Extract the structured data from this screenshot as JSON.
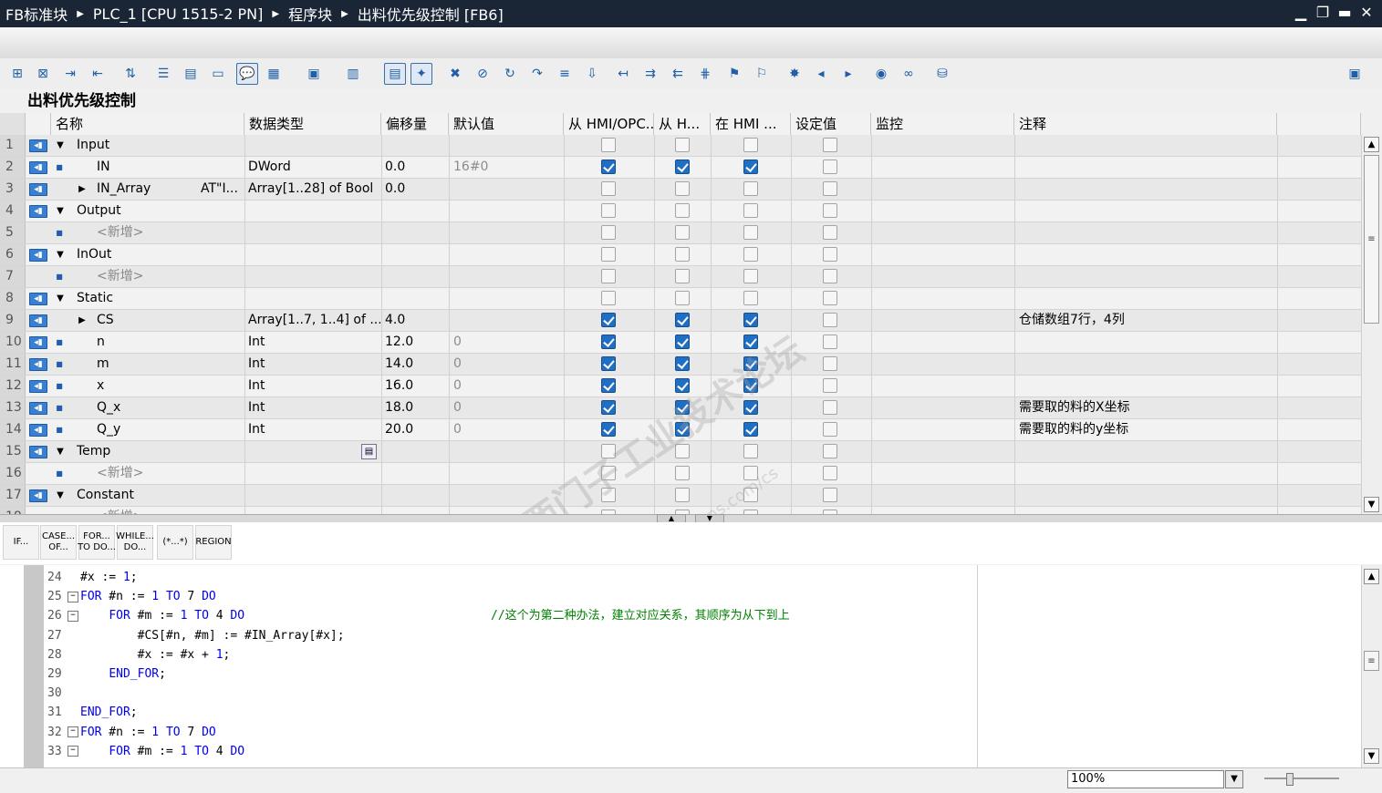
{
  "titlebar": {
    "crumbs": [
      "FB标准块",
      "PLC_1 [CPU 1515-2 PN]",
      "程序块",
      "出料优先级控制 [FB6]"
    ],
    "controls": [
      "▁",
      "❐",
      "▬",
      "✕"
    ]
  },
  "block_title": "出料优先级控制",
  "table": {
    "headers": [
      "名称",
      "数据类型",
      "偏移量",
      "默认值",
      "从 HMI/OPC...",
      "从 H...",
      "在 HMI ...",
      "设定值",
      "监控",
      "注释"
    ],
    "rows": [
      {
        "n": "1",
        "indent": 0,
        "exp": "▼",
        "icon": true,
        "name": "Input",
        "at": "",
        "type": "",
        "offset": "",
        "default": "",
        "cb": [
          0,
          0,
          0,
          0
        ],
        "comment": ""
      },
      {
        "n": "2",
        "indent": 1,
        "exp": "■",
        "icon": true,
        "name": "IN",
        "at": "",
        "type": "DWord",
        "offset": "0.0",
        "default": "16#0",
        "cb": [
          1,
          1,
          1,
          0
        ],
        "comment": ""
      },
      {
        "n": "3",
        "indent": 1,
        "exp": "▶",
        "icon": true,
        "name": "IN_Array",
        "at": "AT\"I...",
        "type": "Array[1..28] of Bool",
        "offset": "0.0",
        "default": "",
        "cb": [
          0,
          0,
          0,
          0
        ],
        "comment": ""
      },
      {
        "n": "4",
        "indent": 0,
        "exp": "▼",
        "icon": true,
        "name": "Output",
        "at": "",
        "type": "",
        "offset": "",
        "default": "",
        "cb": [
          0,
          0,
          0,
          0
        ],
        "comment": ""
      },
      {
        "n": "5",
        "indent": 1,
        "exp": "■",
        "icon": false,
        "name": "<新增>",
        "at": "",
        "type": "",
        "offset": "",
        "default": "",
        "cb": [
          0,
          0,
          0,
          0
        ],
        "comment": "",
        "gray": true
      },
      {
        "n": "6",
        "indent": 0,
        "exp": "▼",
        "icon": true,
        "name": "InOut",
        "at": "",
        "type": "",
        "offset": "",
        "default": "",
        "cb": [
          0,
          0,
          0,
          0
        ],
        "comment": ""
      },
      {
        "n": "7",
        "indent": 1,
        "exp": "■",
        "icon": false,
        "name": "<新增>",
        "at": "",
        "type": "",
        "offset": "",
        "default": "",
        "cb": [
          0,
          0,
          0,
          0
        ],
        "comment": "",
        "gray": true
      },
      {
        "n": "8",
        "indent": 0,
        "exp": "▼",
        "icon": true,
        "name": "Static",
        "at": "",
        "type": "",
        "offset": "",
        "default": "",
        "cb": [
          0,
          0,
          0,
          0
        ],
        "comment": ""
      },
      {
        "n": "9",
        "indent": 1,
        "exp": "▶",
        "icon": true,
        "name": "CS",
        "at": "",
        "type": "Array[1..7, 1..4] of ...",
        "offset": "4.0",
        "default": "",
        "cb": [
          1,
          1,
          1,
          0
        ],
        "comment": "仓储数组7行，4列"
      },
      {
        "n": "10",
        "indent": 1,
        "exp": "■",
        "icon": true,
        "name": "n",
        "at": "",
        "type": "Int",
        "offset": "12.0",
        "default": "0",
        "cb": [
          1,
          1,
          1,
          0
        ],
        "comment": ""
      },
      {
        "n": "11",
        "indent": 1,
        "exp": "■",
        "icon": true,
        "name": "m",
        "at": "",
        "type": "Int",
        "offset": "14.0",
        "default": "0",
        "cb": [
          1,
          1,
          1,
          0
        ],
        "comment": ""
      },
      {
        "n": "12",
        "indent": 1,
        "exp": "■",
        "icon": true,
        "name": "x",
        "at": "",
        "type": "Int",
        "offset": "16.0",
        "default": "0",
        "cb": [
          1,
          1,
          1,
          0
        ],
        "comment": ""
      },
      {
        "n": "13",
        "indent": 1,
        "exp": "■",
        "icon": true,
        "name": "Q_x",
        "at": "",
        "type": "Int",
        "offset": "18.0",
        "default": "0",
        "cb": [
          1,
          1,
          1,
          0
        ],
        "comment": "需要取的料的X坐标"
      },
      {
        "n": "14",
        "indent": 1,
        "exp": "■",
        "icon": true,
        "name": "Q_y",
        "at": "",
        "type": "Int",
        "offset": "20.0",
        "default": "0",
        "cb": [
          1,
          1,
          1,
          0
        ],
        "comment": "需要取的料的y坐标"
      },
      {
        "n": "15",
        "indent": 0,
        "exp": "▼",
        "icon": true,
        "name": "Temp",
        "at": "",
        "type": "",
        "offset": "",
        "default": "",
        "cb": [
          0,
          0,
          0,
          0
        ],
        "comment": ""
      },
      {
        "n": "16",
        "indent": 1,
        "exp": "■",
        "icon": false,
        "name": "<新增>",
        "at": "",
        "type": "",
        "offset": "",
        "default": "",
        "cb": [
          0,
          0,
          0,
          0
        ],
        "comment": "",
        "gray": true
      },
      {
        "n": "17",
        "indent": 0,
        "exp": "▼",
        "icon": true,
        "name": "Constant",
        "at": "",
        "type": "",
        "offset": "",
        "default": "",
        "cb": [
          0,
          0,
          0,
          0
        ],
        "comment": ""
      },
      {
        "n": "18",
        "indent": 1,
        "exp": "■",
        "icon": false,
        "name": "<新增>",
        "at": "",
        "type": "",
        "offset": "",
        "default": "",
        "cb": [
          0,
          0,
          0,
          0
        ],
        "comment": "",
        "gray": true
      }
    ]
  },
  "watermark": {
    "main": "西门子工业技术论坛",
    "sub": "support.industry.siemens.com/cs"
  },
  "snippets": [
    "IF...",
    "CASE...\nOF...",
    "FOR...\nTO DO...",
    "WHILE...\nDO...",
    "(*...*)",
    "REGION"
  ],
  "code": {
    "lines": [
      {
        "ln": "24",
        "fold": "",
        "indent": "",
        "text": "#x := 1;"
      },
      {
        "ln": "25",
        "fold": "−",
        "indent": "",
        "text": "FOR #n := 1 TO 7 DO"
      },
      {
        "ln": "26",
        "fold": "−",
        "indent": "    ",
        "text": "FOR #m := 1 TO 4 DO",
        "comment": "//这个为第二种办法，建立对应关系，其顺序为从下到上"
      },
      {
        "ln": "27",
        "fold": "",
        "indent": "        ",
        "text": "#CS[#n, #m] := #IN_Array[#x];"
      },
      {
        "ln": "28",
        "fold": "",
        "indent": "        ",
        "text": "#x := #x + 1;"
      },
      {
        "ln": "29",
        "fold": "",
        "indent": "    ",
        "text": "END_FOR;"
      },
      {
        "ln": "30",
        "fold": "",
        "indent": "",
        "text": ""
      },
      {
        "ln": "31",
        "fold": "",
        "indent": "",
        "text": "END_FOR;"
      },
      {
        "ln": "32",
        "fold": "−",
        "indent": "",
        "text": "FOR #n := 1 TO 7 DO"
      },
      {
        "ln": "33",
        "fold": "−",
        "indent": "    ",
        "text": "FOR #m := 1 TO 4 DO"
      }
    ]
  },
  "status": {
    "zoom": "100%"
  },
  "colors": {
    "titlebar": "#1a2536",
    "checked": "#1f6fc5",
    "keyword": "#0000ee",
    "comment": "#008000"
  }
}
